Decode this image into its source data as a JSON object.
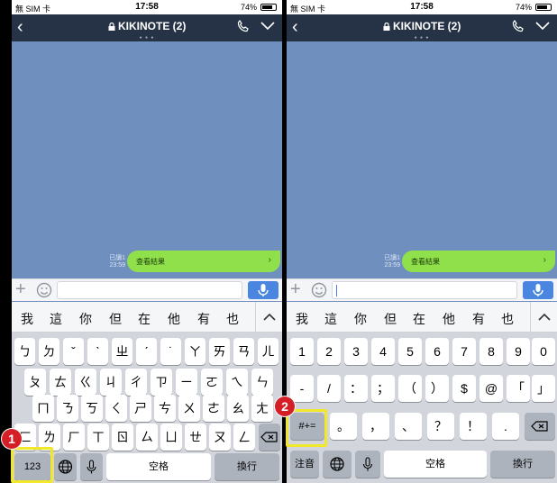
{
  "status": {
    "carrier": "無 SIM 卡",
    "time": "17:58",
    "battery": "74%"
  },
  "chat": {
    "title": "KIKINOTE (2)",
    "message": "查看結果",
    "read_label": "已讀1",
    "timestamp": "23:59"
  },
  "candidates": [
    "我",
    "這",
    "你",
    "但",
    "在",
    "他",
    "有",
    "也"
  ],
  "kb1": {
    "row1": [
      "ㄅ",
      "ㄉ",
      "ˇ",
      "ˋ",
      "ㄓ",
      "ˊ",
      "˙",
      "ㄚ",
      "ㄞ",
      "ㄢ",
      "ㄦ"
    ],
    "row2": [
      "ㄆ",
      "ㄊ",
      "ㄍ",
      "ㄐ",
      "ㄔ",
      "ㄗ",
      "ㄧ",
      "ㄛ",
      "ㄟ",
      "ㄣ"
    ],
    "row3": [
      "ㄇ",
      "ㄋ",
      "ㄎ",
      "ㄑ",
      "ㄕ",
      "ㄘ",
      "ㄨ",
      "ㄜ",
      "ㄠ",
      "ㄤ"
    ],
    "row4": [
      "ㄈ",
      "ㄌ",
      "ㄏ",
      "ㄒ",
      "ㄖ",
      "ㄙ",
      "ㄩ",
      "ㄝ",
      "ㄡ",
      "ㄥ"
    ],
    "numbers_label": "123",
    "space_label": "空格",
    "return_label": "換行"
  },
  "kb2": {
    "row1": [
      "1",
      "2",
      "3",
      "4",
      "5",
      "6",
      "7",
      "8",
      "9",
      "0"
    ],
    "row2": [
      "-",
      "/",
      "：",
      "；",
      "（",
      "）",
      "$",
      "@",
      "「",
      "」"
    ],
    "row3": [
      "。",
      "，",
      "、",
      "？",
      "！",
      "."
    ],
    "symbols_label": "#+=",
    "zhuyin_label": "注音",
    "space_label": "空格",
    "return_label": "換行"
  },
  "annotations": {
    "step1": "1",
    "step2": "2",
    "highlight_color": "#f1e82b",
    "badge_color": "#d41f27"
  }
}
